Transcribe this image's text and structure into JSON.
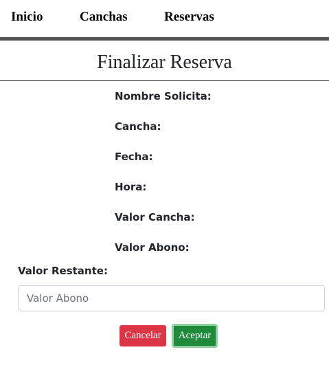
{
  "nav": {
    "items": [
      {
        "label": "Inicio"
      },
      {
        "label": "Canchas"
      },
      {
        "label": "Reservas"
      }
    ],
    "bar_color": "#555555"
  },
  "page": {
    "title": "Finalizar Reserva"
  },
  "details": {
    "nombre_solicita": "Nombre Solicita:",
    "cancha": "Cancha:",
    "fecha": "Fecha:",
    "hora": "Hora:",
    "valor_cancha": "Valor Cancha:",
    "valor_abono": "Valor Abono:"
  },
  "form": {
    "valor_restante_label": "Valor Restante:",
    "abono_input": {
      "value": "",
      "placeholder": "Valor Abono"
    }
  },
  "actions": {
    "cancel_label": "Cancelar",
    "accept_label": "Aceptar",
    "cancel_color": "#dc3545",
    "accept_color": "#1e8a3a"
  }
}
